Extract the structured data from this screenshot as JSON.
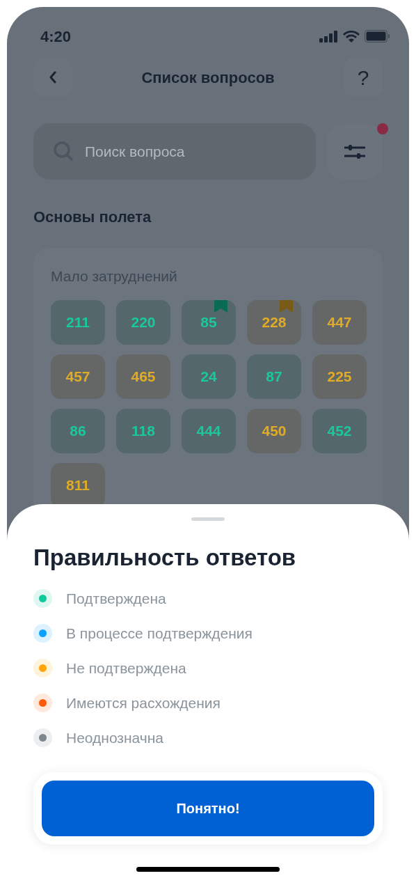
{
  "status_bar": {
    "time": "4:20"
  },
  "header": {
    "title": "Список вопросов",
    "help": "?"
  },
  "search": {
    "placeholder": "Поиск вопроса",
    "filter_badge": true
  },
  "section": {
    "title": "Основы полета",
    "card": {
      "title": "Мало затруднений",
      "questions": [
        {
          "number": "211",
          "kind": "confirmed",
          "bookmarked": false
        },
        {
          "number": "220",
          "kind": "confirmed",
          "bookmarked": false
        },
        {
          "number": "85",
          "kind": "confirmed",
          "bookmarked": true
        },
        {
          "number": "228",
          "kind": "unconfirmed",
          "bookmarked": true
        },
        {
          "number": "447",
          "kind": "unconfirmed",
          "bookmarked": false
        },
        {
          "number": "457",
          "kind": "unconfirmed",
          "bookmarked": false
        },
        {
          "number": "465",
          "kind": "unconfirmed",
          "bookmarked": false
        },
        {
          "number": "24",
          "kind": "confirmed",
          "bookmarked": false
        },
        {
          "number": "87",
          "kind": "confirmed",
          "bookmarked": false
        },
        {
          "number": "225",
          "kind": "unconfirmed",
          "bookmarked": false
        },
        {
          "number": "86",
          "kind": "confirmed",
          "bookmarked": false
        },
        {
          "number": "118",
          "kind": "confirmed",
          "bookmarked": false
        },
        {
          "number": "444",
          "kind": "confirmed",
          "bookmarked": false
        },
        {
          "number": "450",
          "kind": "unconfirmed",
          "bookmarked": false
        },
        {
          "number": "452",
          "kind": "confirmed",
          "bookmarked": false
        },
        {
          "number": "811",
          "kind": "unconfirmed",
          "bookmarked": false
        }
      ]
    }
  },
  "sheet": {
    "title": "Правильность ответов",
    "legend": [
      {
        "label": "Подтверждена",
        "color": "#12c99b"
      },
      {
        "label": "В процессе подтверждения",
        "color": "#0aa0ff"
      },
      {
        "label": "Не подтверждена",
        "color": "#ffa70a"
      },
      {
        "label": "Имеются расхождения",
        "color": "#ff5c0a"
      },
      {
        "label": "Неоднозначна",
        "color": "#7d8790"
      }
    ],
    "button": "Понятно!"
  }
}
